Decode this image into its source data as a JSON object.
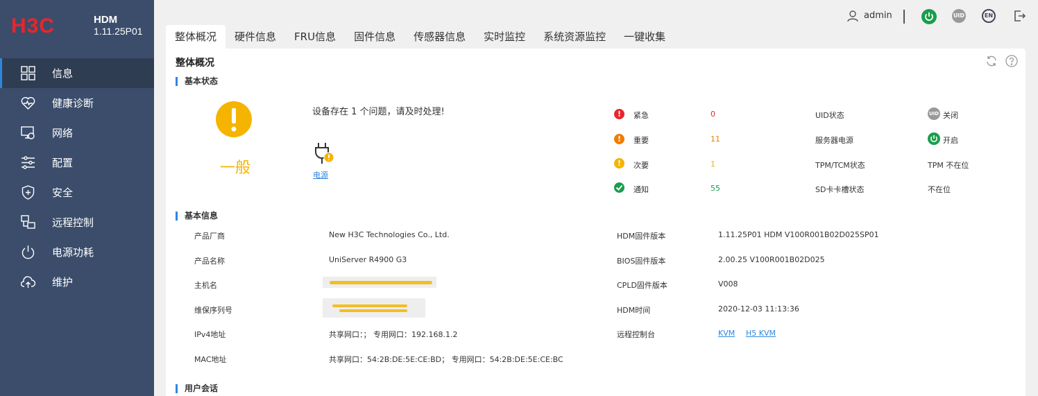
{
  "brand": {
    "logo_text": "H3C",
    "name": "HDM",
    "version": "1.11.25P01"
  },
  "sidebar": {
    "items": [
      {
        "label": "信息",
        "icon": "grid-icon"
      },
      {
        "label": "健康诊断",
        "icon": "heart-pulse-icon"
      },
      {
        "label": "网络",
        "icon": "network-icon"
      },
      {
        "label": "配置",
        "icon": "sliders-icon"
      },
      {
        "label": "安全",
        "icon": "shield-icon"
      },
      {
        "label": "远程控制",
        "icon": "remote-control-icon"
      },
      {
        "label": "电源功耗",
        "icon": "power-icon"
      },
      {
        "label": "维护",
        "icon": "cloud-upload-icon"
      }
    ]
  },
  "topbar": {
    "user": "admin",
    "uid_label": "UID",
    "lang_label": "EN"
  },
  "tabs": [
    "整体概况",
    "硬件信息",
    "FRU信息",
    "固件信息",
    "传感器信息",
    "实时监控",
    "系统资源监控",
    "一键收集"
  ],
  "page": {
    "title": "整体概况"
  },
  "basic_status": {
    "title": "基本状态",
    "level": "一般",
    "message": "设备存在 1 个问题，请及时处理!",
    "problem_link": "电源",
    "alerts": [
      {
        "label": "紧急",
        "value": "0",
        "color": "#e8262d"
      },
      {
        "label": "重要",
        "value": "11",
        "color": "#f07c00"
      },
      {
        "label": "次要",
        "value": "1",
        "color": "#f5b400"
      },
      {
        "label": "通知",
        "value": "55",
        "color": "#1a9e4b"
      }
    ],
    "states": [
      {
        "label": "UID状态",
        "value": "关闭"
      },
      {
        "label": "服务器电源",
        "value": "开启"
      },
      {
        "label": "TPM/TCM状态",
        "value": "TPM 不在位"
      },
      {
        "label": "SD卡卡槽状态",
        "value": "不在位"
      }
    ]
  },
  "basic_info": {
    "title": "基本信息",
    "left": [
      {
        "label": "产品厂商",
        "value": "New H3C Technologies Co., Ltd."
      },
      {
        "label": "产品名称",
        "value": "UniServer R4900 G3"
      },
      {
        "label": "主机名",
        "value": ""
      },
      {
        "label": "维保序列号",
        "value": ""
      },
      {
        "label": "IPv4地址",
        "value": "共享网口：；    专用网口：192.168.1.2"
      },
      {
        "label": "MAC地址",
        "value": "共享网口：54:2B:DE:5E:CE:BD；    专用网口：54:2B:DE:5E:CE:BC"
      }
    ],
    "right": [
      {
        "label": "HDM固件版本",
        "value": "1.11.25P01 HDM V100R001B02D025SP01"
      },
      {
        "label": "BIOS固件版本",
        "value": "2.00.25 V100R001B02D025"
      },
      {
        "label": "CPLD固件版本",
        "value": "V008"
      },
      {
        "label": "HDM时间",
        "value": "2020-12-03 11:13:36"
      },
      {
        "label": "远程控制台",
        "links": [
          "KVM",
          "H5 KVM"
        ]
      }
    ]
  },
  "sessions": {
    "title": "用户会话"
  }
}
